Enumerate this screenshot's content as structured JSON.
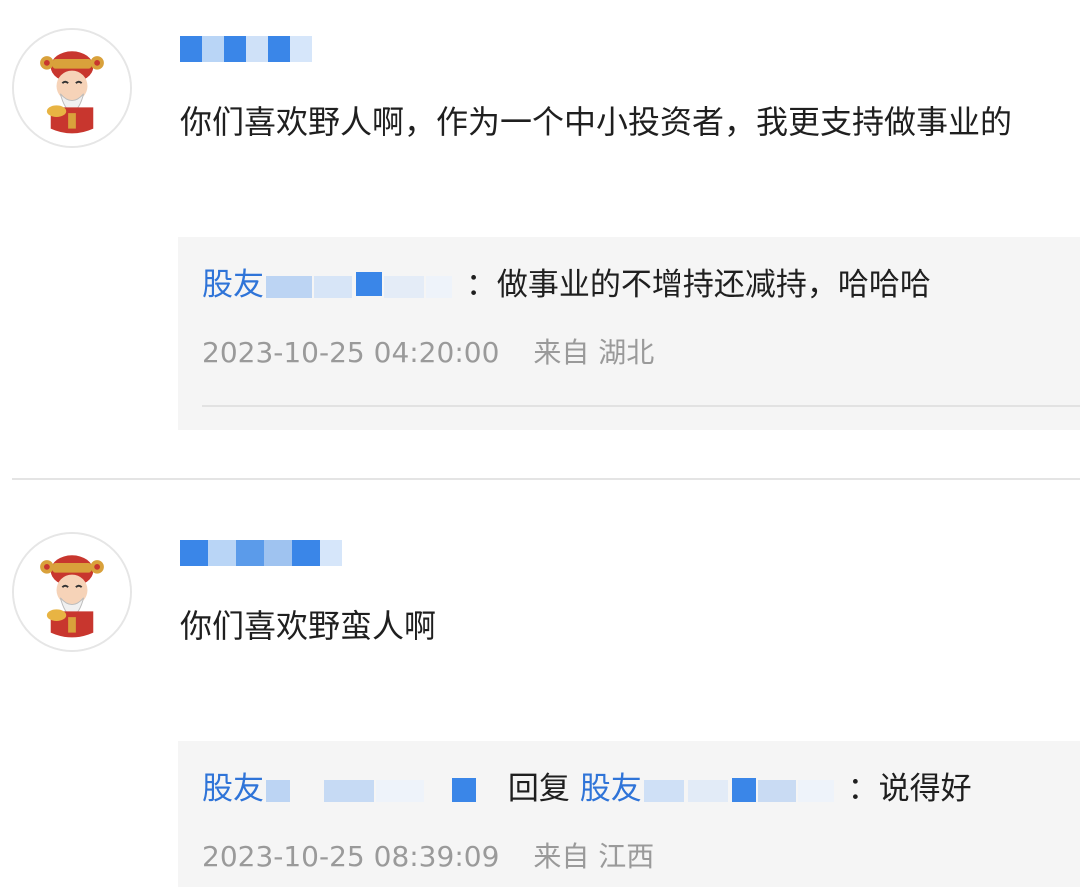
{
  "comments": [
    {
      "username": "",
      "avatar": "caishen-avatar-icon",
      "content": "你们喜欢野人啊，作为一个中小投资者，我更支持做事业的",
      "reply": {
        "author_prefix": "股友",
        "separator": "：",
        "text": "做事业的不增持还减持，哈哈哈",
        "time": "2023-10-25 04:20:00",
        "location": "来自 湖北"
      }
    },
    {
      "username": "",
      "avatar": "caishen-avatar-icon",
      "content": "你们喜欢野蛮人啊",
      "reply": {
        "author_prefix": "股友",
        "reply_word": "回复",
        "target_prefix": "股友",
        "separator": "：",
        "text": "说得好",
        "time": "2023-10-25 08:39:09",
        "location": "来自 江西"
      }
    }
  ],
  "colors": {
    "link": "#2f74d8",
    "meta": "#9a9a9a",
    "reply_bg": "#f5f5f5"
  }
}
